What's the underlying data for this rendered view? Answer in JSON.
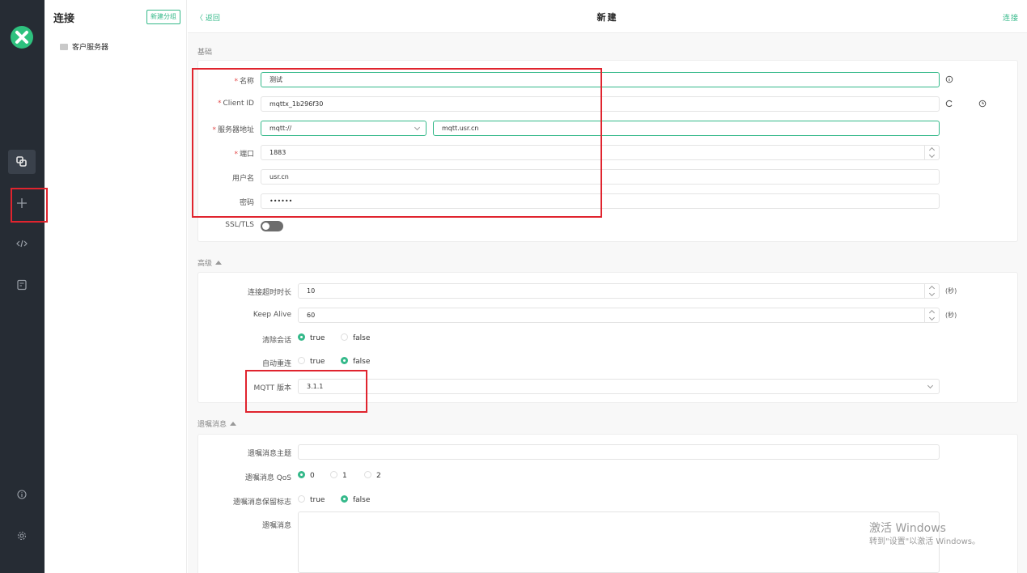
{
  "sidebar": {
    "logo": "mqttx-logo-icon",
    "nav": [
      {
        "name": "connections-icon",
        "active": true
      },
      {
        "name": "plus-icon",
        "active": false
      },
      {
        "name": "code-icon",
        "active": false
      },
      {
        "name": "log-icon",
        "active": false
      }
    ],
    "bottom": [
      "info-icon",
      "gear-icon"
    ]
  },
  "connections_panel": {
    "title": "连接",
    "new_group": "新建分组",
    "groups": [
      {
        "label": "客户服务器",
        "icon": "folder-icon"
      }
    ]
  },
  "topbar": {
    "back": "〈 返回",
    "title": "新建",
    "connect": "连接"
  },
  "basic": {
    "section_title": "基础",
    "name_label": "名称",
    "name_value": "测试",
    "client_id_label": "Client ID",
    "client_id_value": "mqttx_1b296f30",
    "host_label": "服务器地址",
    "protocol_value": "mqtt://",
    "host_value": "mqtt.usr.cn",
    "port_label": "端口",
    "port_value": "1883",
    "username_label": "用户名",
    "username_value": "usr.cn",
    "password_label": "密码",
    "password_value": "••••••",
    "ssl_label": "SSL/TLS",
    "ssl_on": false
  },
  "advanced": {
    "section_title": "高级",
    "timeout_label": "连接超时时长",
    "timeout_value": "10",
    "timeout_unit": "(秒)",
    "keepalive_label": "Keep Alive",
    "keepalive_value": "60",
    "keepalive_unit": "(秒)",
    "clean_label": "清除会话",
    "clean_options": [
      "true",
      "false"
    ],
    "clean_selected": "true",
    "reconnect_label": "自动重连",
    "reconnect_options": [
      "true",
      "false"
    ],
    "reconnect_selected": "false",
    "mqtt_version_label": "MQTT 版本",
    "mqtt_version_value": "3.1.1"
  },
  "will": {
    "section_title": "遗嘱消息",
    "topic_label": "遗嘱消息主题",
    "topic_value": "",
    "qos_label": "遗嘱消息 QoS",
    "qos_options": [
      "0",
      "1",
      "2"
    ],
    "qos_selected": "0",
    "retain_label": "遗嘱消息保留标志",
    "retain_options": [
      "true",
      "false"
    ],
    "retain_selected": "false",
    "payload_label": "遗嘱消息"
  },
  "watermark": {
    "line1": "激活 Windows",
    "line2": "转到\"设置\"以激活 Windows。"
  },
  "colors": {
    "accent": "#35b98a",
    "rail": "#262c34",
    "required": "#e34b4b",
    "annotation": "#e0242e"
  }
}
